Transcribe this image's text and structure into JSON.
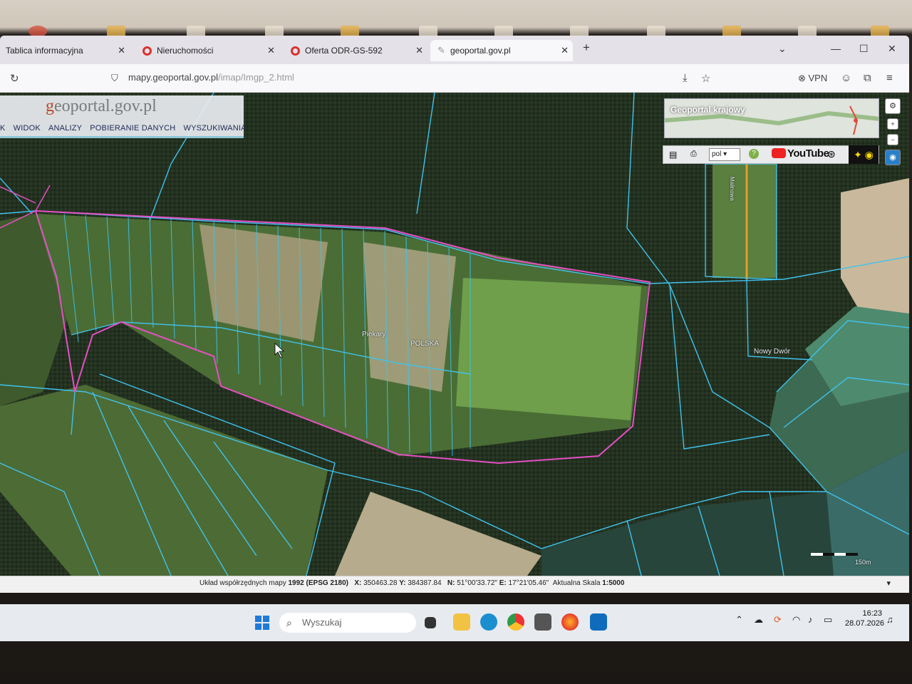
{
  "browser": {
    "tabs": [
      {
        "title": "Tablica informacyjna"
      },
      {
        "title": "Nieruchomości"
      },
      {
        "title": "Oferta ODR-GS-592"
      },
      {
        "title": "geoportal.gov.pl"
      }
    ],
    "new_tab": "+",
    "url_host": "mapy.geoportal.gov.pl",
    "url_path": "/imap/Imgp_2.html",
    "vpn_label": "VPN"
  },
  "geoportal": {
    "brand": "geoportal.gov.pl",
    "menu": [
      "K",
      "WIDOK",
      "ANALIZY",
      "POBIERANIE DANYCH",
      "WYSZUKIWANIA"
    ],
    "overview_label": "Geoportal krajowy",
    "language": "pol",
    "youtube_label": "YouTube",
    "map_labels": {
      "piekary": "Piekary",
      "polska": "POLSKA",
      "nowy_dwor": "Nowy Dwór",
      "malinowa": "Malinowa"
    },
    "scalebar_label": "150m"
  },
  "status": {
    "crs_label": "Układ współrzędnych mapy",
    "crs_value": "1992 (EPSG 2180)",
    "x_label": "X:",
    "x_value": "350463.28",
    "y_label": "Y:",
    "y_value": "384387.84",
    "n_label": "N:",
    "n_value": "51°00'33.72\"",
    "e_label": "E:",
    "e_value": "17°21'05.46\"",
    "scale_label": "Aktualna Skala",
    "scale_value": "1:5000"
  },
  "taskbar": {
    "search_placeholder": "Wyszukaj",
    "time": "16:23",
    "date": "28.07.2026"
  },
  "colors": {
    "parcel_line": "#3fc3ee",
    "selection_line": "#e64fc4",
    "forest": "#243322",
    "meadow": "#5c8a3a"
  }
}
